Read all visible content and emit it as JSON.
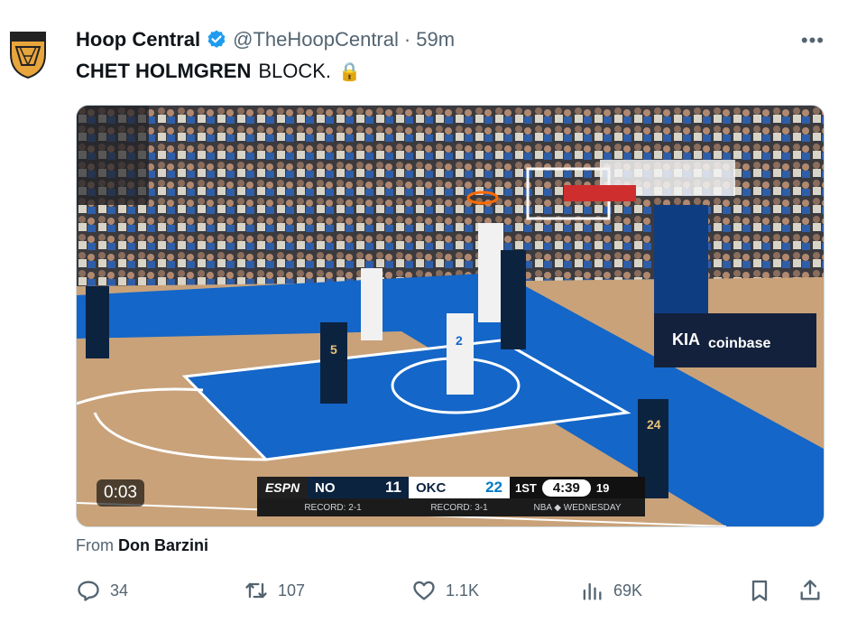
{
  "tweet": {
    "display_name": "Hoop Central",
    "handle": "@TheHoopCentral",
    "separator": "·",
    "time": "59m",
    "more_label": "•••",
    "text_bold": "CHET HOLMGREN",
    "text_rest": "BLOCK.",
    "text_emoji": "🔒",
    "media": {
      "duration": "0:03",
      "scorebug": {
        "network": "ESPN",
        "team1": "NO",
        "score1": "11",
        "team2": "OKC",
        "score2": "22",
        "quarter": "1ST",
        "clock": "4:39",
        "shot_clock": "19",
        "record1": "RECORD: 2-1",
        "record2": "RECORD: 3-1",
        "brand": "NBA ◆ WEDNESDAY"
      },
      "players": {
        "p1": "5",
        "p2": "2",
        "p3": "24"
      }
    },
    "from_label": "From",
    "from_name": "Don Barzini",
    "actions": {
      "reply_count": "34",
      "retweet_count": "107",
      "like_count": "1.1K",
      "views_count": "69K"
    }
  },
  "colors": {
    "court_wood": "#c9a27a",
    "court_blue": "#1466c8",
    "accent_blue": "#1d9bf0",
    "muted_text": "#536471"
  }
}
